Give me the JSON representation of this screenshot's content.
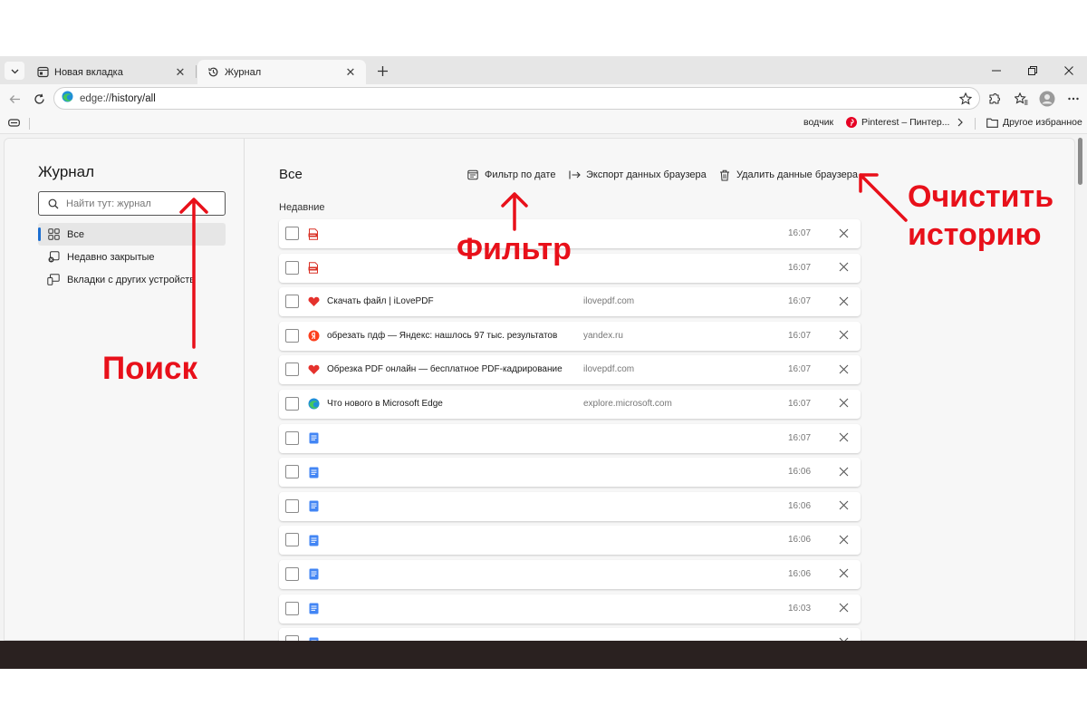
{
  "tabs": [
    {
      "title": "Новая вкладка",
      "icon": "new-tab-page-icon",
      "active": false
    },
    {
      "title": "Журнал",
      "icon": "history-icon",
      "active": true
    }
  ],
  "address_bar": {
    "url_prefix": "edge://",
    "url_main": "history/all"
  },
  "favorites": {
    "item1": "водчик",
    "item2": "Pinterest – Пинтер...",
    "other_folder": "Другое избранное"
  },
  "sidebar": {
    "title": "Журнал",
    "search_placeholder": "Найти тут: журнал",
    "items": [
      {
        "label": "Все",
        "icon": "grid-icon",
        "active": true
      },
      {
        "label": "Недавно закрытые",
        "icon": "recently-closed-icon",
        "active": false
      },
      {
        "label": "Вкладки с других устройств",
        "icon": "devices-icon",
        "active": false
      }
    ]
  },
  "main": {
    "title": "Все",
    "filter_label": "Фильтр по дате",
    "export_label": "Экспорт данных браузера",
    "delete_label": "Удалить данные браузера",
    "section_label": "Недавние",
    "rows": [
      {
        "icon": "pdf-icon",
        "title": "",
        "domain": "",
        "time": "16:07"
      },
      {
        "icon": "pdf-icon",
        "title": "",
        "domain": "",
        "time": "16:07"
      },
      {
        "icon": "ilovepdf-icon",
        "title": "Скачать файл | iLovePDF",
        "domain": "ilovepdf.com",
        "time": "16:07"
      },
      {
        "icon": "yandex-icon",
        "title": "обрезать пдф — Яндекс: нашлось 97 тыс. результатов",
        "domain": "yandex.ru",
        "time": "16:07"
      },
      {
        "icon": "ilovepdf-icon",
        "title": "Обрезка PDF онлайн — бесплатное PDF-кадрирование",
        "domain": "ilovepdf.com",
        "time": "16:07"
      },
      {
        "icon": "edge-icon",
        "title": "Что нового в Microsoft Edge",
        "domain": "explore.microsoft.com",
        "time": "16:07"
      },
      {
        "icon": "google-docs-icon",
        "title": "",
        "domain": "",
        "time": "16:07"
      },
      {
        "icon": "google-docs-icon",
        "title": "",
        "domain": "",
        "time": "16:06"
      },
      {
        "icon": "google-docs-icon",
        "title": "",
        "domain": "",
        "time": "16:06"
      },
      {
        "icon": "google-docs-icon",
        "title": "",
        "domain": "",
        "time": "16:06"
      },
      {
        "icon": "google-docs-icon",
        "title": "",
        "domain": "",
        "time": "16:06"
      },
      {
        "icon": "google-docs-icon",
        "title": "",
        "domain": "",
        "time": "16:03"
      },
      {
        "icon": "google-docs-icon",
        "title": "",
        "domain": "",
        "time": ""
      }
    ]
  },
  "annotations": {
    "search": "Поиск",
    "filter": "Фильтр",
    "clear_line1": "Очистить",
    "clear_line2": "историю"
  },
  "colors": {
    "annotation_red": "#e8101a",
    "accent_blue": "#1c6fd1",
    "taskbar": "#2a2120"
  }
}
